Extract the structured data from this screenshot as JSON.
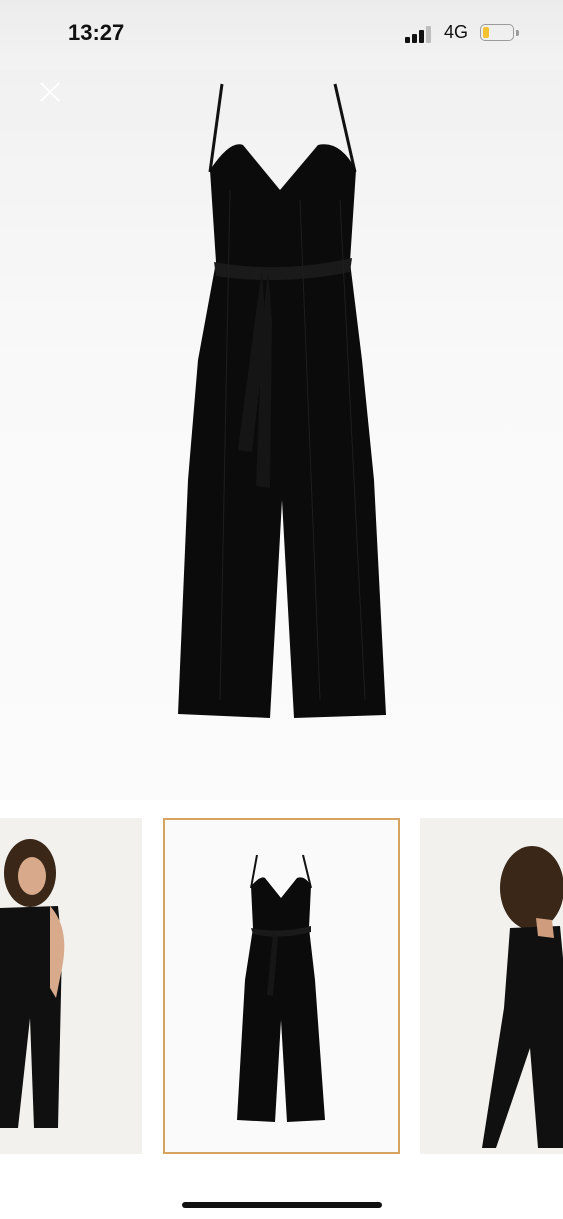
{
  "status_bar": {
    "time": "13:27",
    "network": "4G",
    "signal_bars": 3,
    "battery_level": 0.2,
    "battery_color": "#f2c230"
  },
  "viewer": {
    "close_icon": "close-icon",
    "selected_thumbnail_index": 1,
    "selected_border_color": "#d6a45f",
    "product_color": "#0b0b0b"
  },
  "thumbnails": [
    {
      "name": "model-front"
    },
    {
      "name": "product-flatlay"
    },
    {
      "name": "model-back"
    }
  ]
}
